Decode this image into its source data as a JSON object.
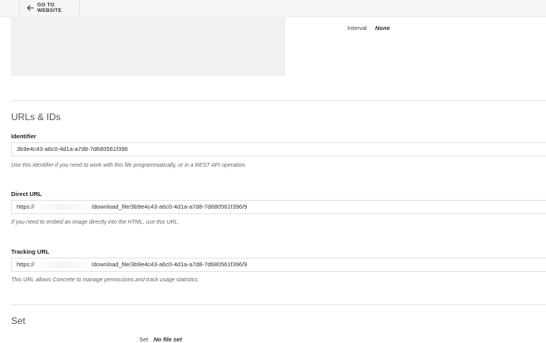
{
  "topbar": {
    "go_website_label": "GO TO WEBSITE",
    "back_icon": "arrow-left-icon"
  },
  "details": {
    "interval_label": "Interval",
    "interval_value": "None"
  },
  "urls_section": {
    "title": "URLs & IDs",
    "identifier": {
      "label": "Identifier",
      "value": "3b9e4c43-a6c0-4d1a-a7d8-7d680561f396",
      "help": "Use this identifier if you need to work with this file programmatically, or in a REST API operation."
    },
    "direct_url": {
      "label": "Direct URL",
      "prefix": "https://",
      "suffix": "/download_file/3b9e4c43-a6c0-4d1a-a7d8-7d680561f396/9",
      "help": "If you need to embed an image directly into the HTML, use this URL."
    },
    "tracking_url": {
      "label": "Tracking URL",
      "prefix": "https://",
      "suffix": "/download_file/3b9e4c43-a6c0-4d1a-a7d8-7d680561f396/9",
      "help": "This URL allows Concrete to manage permissions and track usage statistics."
    }
  },
  "set_section": {
    "title": "Set",
    "row_label": "Set",
    "row_value": "No file set"
  }
}
